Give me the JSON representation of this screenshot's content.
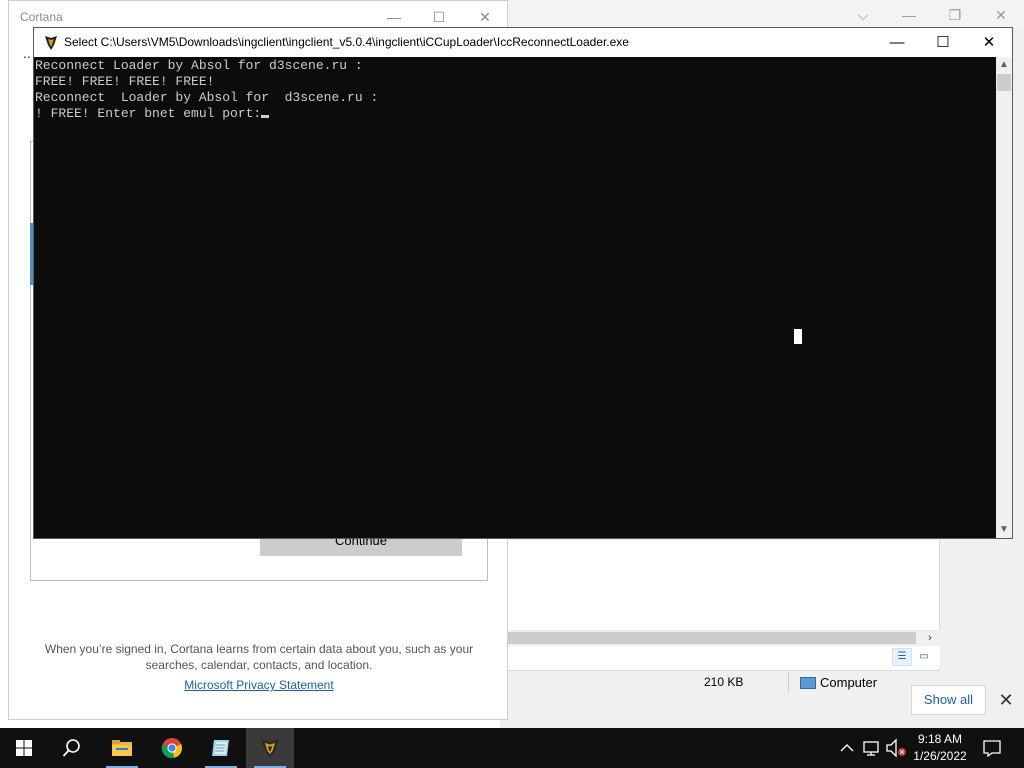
{
  "explorer": {
    "status_size": "210 KB",
    "status_computer": "Computer"
  },
  "notification": {
    "show_all": "Show all",
    "close": "✕"
  },
  "cortana": {
    "title": "Cortana",
    "dots": "..",
    "continue_label": "Continue",
    "info_text": "When you’re signed in, Cortana learns from certain data about you, such as your searches, calendar, contacts, and location.",
    "privacy_link": "Microsoft Privacy Statement"
  },
  "console": {
    "title": "Select C:\\Users\\VM5\\Downloads\\ingclient\\ingclient_v5.0.4\\ingclient\\iCCupLoader\\IccReconnectLoader.exe",
    "lines": [
      "Reconnect Loader by Absol for d3scene.ru :",
      "FREE! FREE! FREE! FREE!",
      "Reconnect  Loader by Absol for  d3scene.ru :",
      "! FREE! Enter bnet emul port:"
    ]
  },
  "window_controls": {
    "minimize": "—",
    "maximize": "☐",
    "close": "✕",
    "chevron": "⌵",
    "restore": "❐"
  },
  "taskbar": {
    "apps": [
      "start",
      "search",
      "file-explorer",
      "chrome",
      "notepad",
      "iccup-loader"
    ],
    "time": "9:18 AM",
    "date": "1/26/2022",
    "accent_color": "#7fb2e6"
  }
}
